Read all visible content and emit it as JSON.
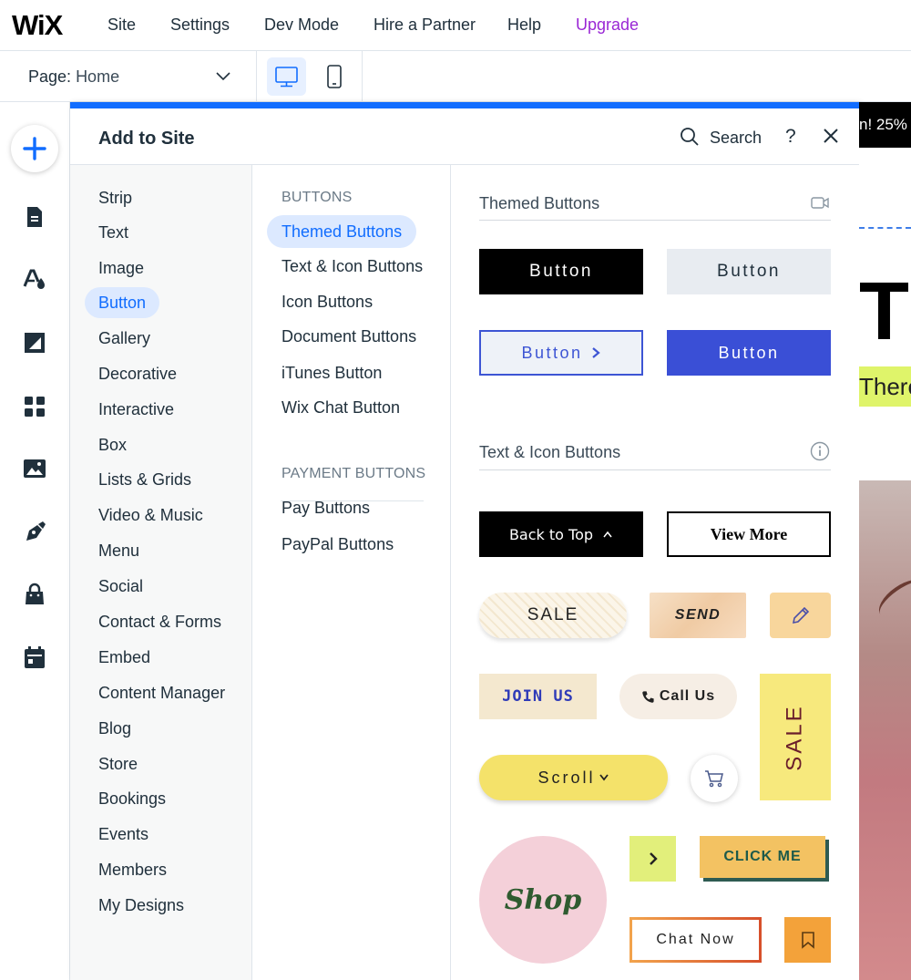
{
  "topbar": {
    "logo": "WiX",
    "menu": [
      "Site",
      "Settings",
      "Dev Mode",
      "Hire a Partner",
      "Help",
      "Upgrade"
    ]
  },
  "pagebar": {
    "label": "Page:",
    "value": "Home"
  },
  "panel": {
    "title": "Add to Site",
    "search_label": "Search",
    "help": "?"
  },
  "categories": [
    "Strip",
    "Text",
    "Image",
    "Button",
    "Gallery",
    "Decorative",
    "Interactive",
    "Box",
    "Lists & Grids",
    "Video & Music",
    "Menu",
    "Social",
    "Contact & Forms",
    "Embed",
    "Content Manager",
    "Blog",
    "Store",
    "Bookings",
    "Events",
    "Members",
    "My Designs"
  ],
  "active_category": "Button",
  "subnav": {
    "section1": "BUTTONS",
    "items1": [
      "Themed Buttons",
      "Text & Icon Buttons",
      "Icon Buttons",
      "Document Buttons",
      "iTunes Button",
      "Wix Chat Button"
    ],
    "section2": "PAYMENT BUTTONS",
    "items2": [
      "Pay Buttons",
      "PayPal Buttons"
    ],
    "active": "Themed Buttons"
  },
  "groups": {
    "themed_title": "Themed Buttons",
    "text_icon_title": "Text & Icon Buttons"
  },
  "samples": {
    "button": "Button",
    "back_to_top": "Back to Top",
    "view_more": "View More",
    "sale": "SALE",
    "send": "SEND",
    "join_us": "JOIN US",
    "call_us": "Call Us",
    "scroll": "Scroll",
    "shop": "Shop",
    "click_me": "CLICK ME",
    "chat_now": "Chat Now"
  },
  "preview": {
    "top_text": "n! 25%",
    "side_text": "There",
    "big_letter": "T"
  },
  "colors": {
    "accent": "#116dff",
    "upgrade": "#9a27d5"
  }
}
